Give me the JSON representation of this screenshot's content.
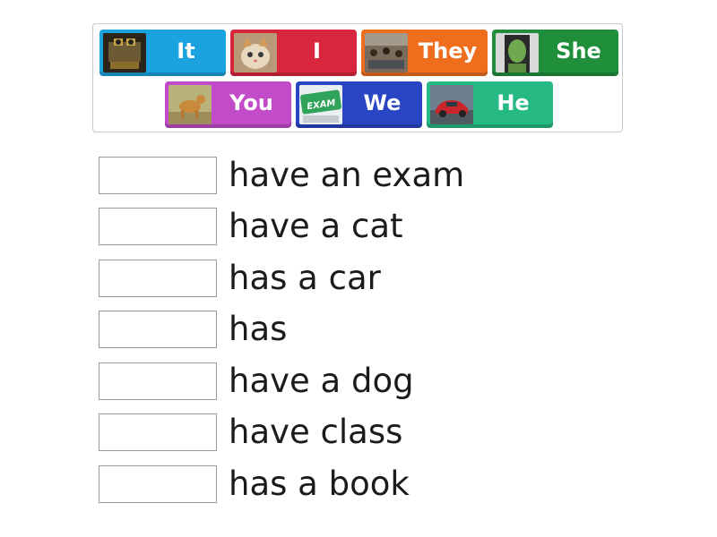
{
  "tiles": [
    {
      "label": "It",
      "color": "#1aa3de",
      "thumb": "robot-photo"
    },
    {
      "label": "I",
      "color": "#d8263c",
      "thumb": "kitten-photo"
    },
    {
      "label": "They",
      "color": "#ef6e1e",
      "thumb": "classroom-photo"
    },
    {
      "label": "She",
      "color": "#1f8f3c",
      "thumb": "she-hulk-photo"
    },
    {
      "label": "You",
      "color": "#c24bc9",
      "thumb": "dog-photo"
    },
    {
      "label": "We",
      "color": "#2a45c4",
      "thumb": "exam-key-photo"
    },
    {
      "label": "He",
      "color": "#26b983",
      "thumb": "red-car-photo"
    }
  ],
  "thumb_text": {
    "exam": "EXAM"
  },
  "sentences": [
    "have an exam",
    "have a cat",
    "has a car",
    "has",
    "have a dog",
    "have class",
    "has a book"
  ]
}
